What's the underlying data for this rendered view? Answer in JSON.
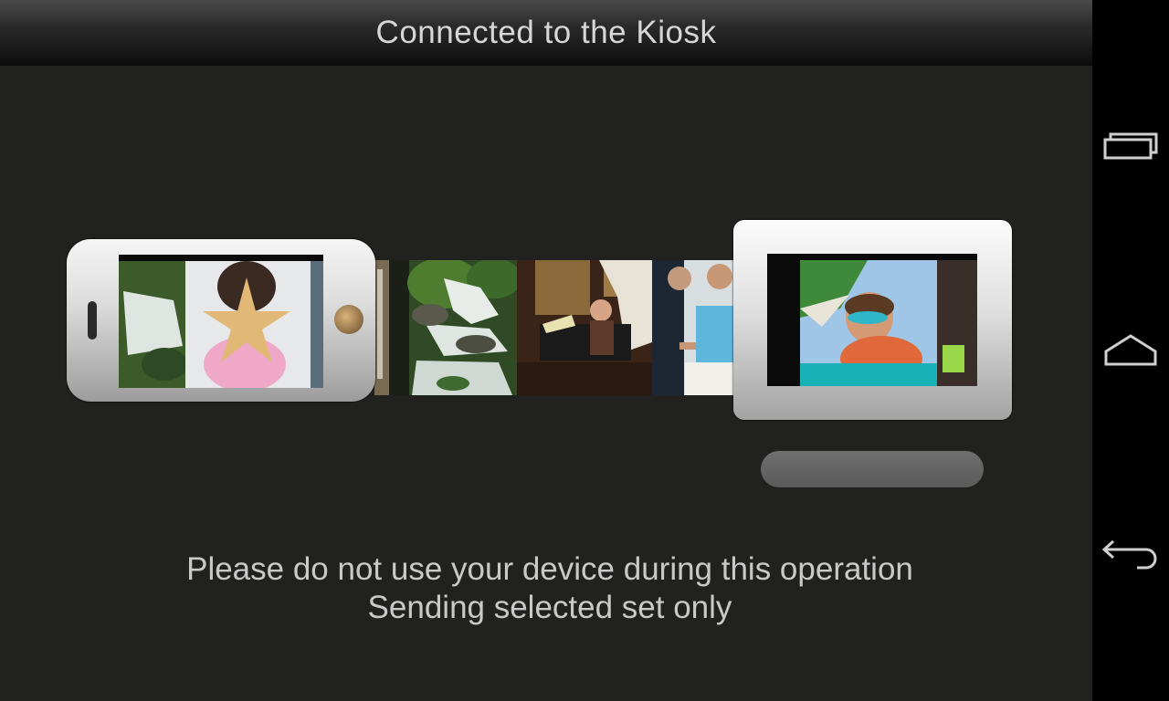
{
  "header": {
    "title": "Connected to the Kiosk"
  },
  "messages": {
    "line1": "Please do not use your device during this operation",
    "line2": "Sending selected set only"
  },
  "photos": {
    "strip": [
      "waterfall-photo",
      "kitchen-family-photo",
      "man-with-phone-photo"
    ],
    "phone_current": "girl-with-starfish-photo",
    "kiosk_current": "boy-with-goggles-photo"
  },
  "nav": {
    "buttons": [
      "recent-apps-icon",
      "home-icon",
      "back-icon"
    ]
  },
  "colors": {
    "background": "#212220",
    "nav_background": "#000000",
    "text": "#c9c9c9"
  }
}
